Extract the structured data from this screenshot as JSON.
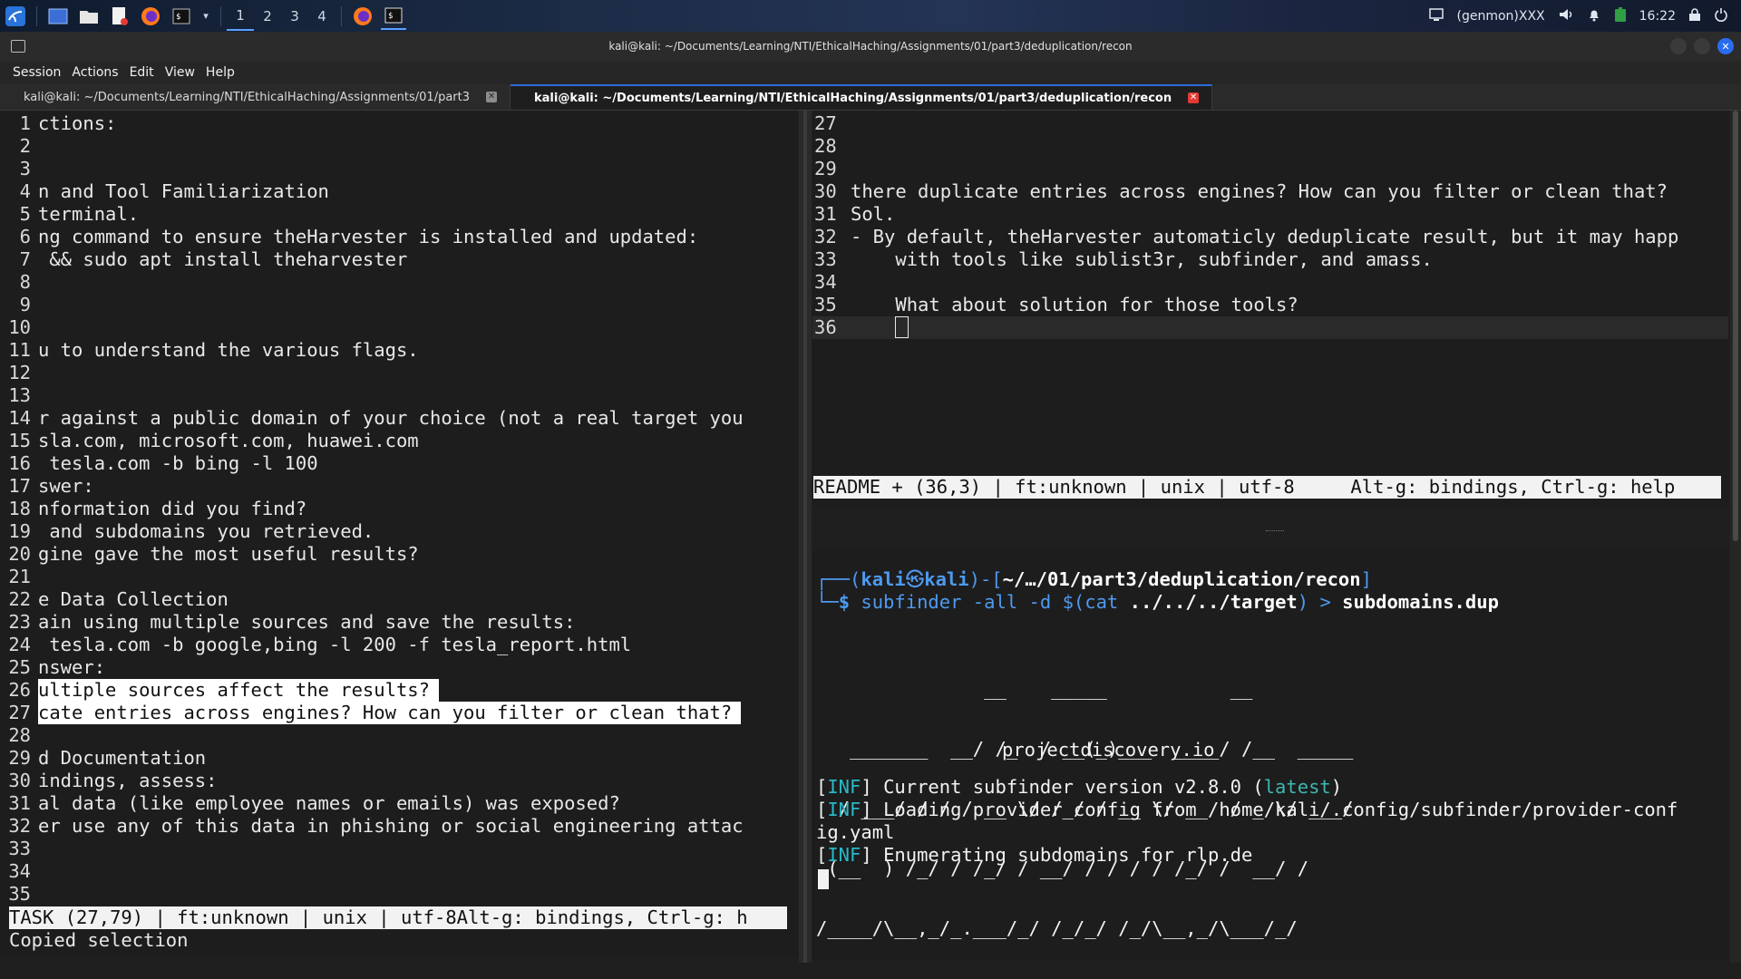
{
  "taskbar": {
    "workspaces": [
      "1",
      "2",
      "3",
      "4"
    ],
    "genmon": "(genmon)XXX",
    "clock": "16:22"
  },
  "window": {
    "title": "kali@kali: ~/Documents/Learning/NTI/EthicalHaching/Assignments/01/part3/deduplication/recon"
  },
  "menu": [
    "Session",
    "Actions",
    "Edit",
    "View",
    "Help"
  ],
  "tabs": [
    {
      "label": "kali@kali: ~/Documents/Learning/NTI/EthicalHaching/Assignments/01/part3",
      "active": false
    },
    {
      "label": "kali@kali: ~/Documents/Learning/NTI/EthicalHaching/Assignments/01/part3/deduplication/recon",
      "active": true
    }
  ],
  "left_editor": {
    "lines": [
      {
        "n": "1",
        "t": "ctions:"
      },
      {
        "n": "2",
        "t": ""
      },
      {
        "n": "3",
        "t": ""
      },
      {
        "n": "4",
        "t": "n and Tool Familiarization"
      },
      {
        "n": "5",
        "t": "terminal."
      },
      {
        "n": "6",
        "t": "ng command to ensure theHarvester is installed and updated:"
      },
      {
        "n": "7",
        "t": " && sudo apt install theharvester"
      },
      {
        "n": "8",
        "t": ""
      },
      {
        "n": "9",
        "t": ""
      },
      {
        "n": "10",
        "t": ""
      },
      {
        "n": "11",
        "t": "u to understand the various flags."
      },
      {
        "n": "12",
        "t": ""
      },
      {
        "n": "13",
        "t": ""
      },
      {
        "n": "14",
        "t": "r against a public domain of your choice (not a real target you"
      },
      {
        "n": "15",
        "t": "sla.com, microsoft.com, huawei.com"
      },
      {
        "n": "16",
        "t": " tesla.com -b bing -l 100"
      },
      {
        "n": "17",
        "t": "swer:"
      },
      {
        "n": "18",
        "t": "nformation did you find?"
      },
      {
        "n": "19",
        "t": " and subdomains you retrieved."
      },
      {
        "n": "20",
        "t": "gine gave the most useful results?"
      },
      {
        "n": "21",
        "t": ""
      },
      {
        "n": "22",
        "t": "e Data Collection"
      },
      {
        "n": "23",
        "t": "ain using multiple sources and save the results:"
      },
      {
        "n": "24",
        "t": " tesla.com -b google,bing -l 200 -f tesla_report.html"
      },
      {
        "n": "25",
        "t": "nswer:"
      },
      {
        "n": "26",
        "t": "ultiple sources affect the results?"
      },
      {
        "n": "27",
        "t": "cate entries across engines? How can you filter or clean that?"
      },
      {
        "n": "28",
        "t": ""
      },
      {
        "n": "29",
        "t": "d Documentation"
      },
      {
        "n": "30",
        "t": "indings, assess:"
      },
      {
        "n": "31",
        "t": "al data (like employee names or emails) was exposed?"
      },
      {
        "n": "32",
        "t": "er use any of this data in phishing or social engineering attac"
      },
      {
        "n": "33",
        "t": ""
      },
      {
        "n": "34",
        "t": ""
      },
      {
        "n": "35",
        "t": ""
      }
    ],
    "status": "TASK (27,79) | ft:unknown | unix | utf-8Alt-g: bindings, Ctrl-g: h",
    "message": "Copied selection"
  },
  "right_editor": {
    "lines": [
      {
        "n": "27",
        "t": ""
      },
      {
        "n": "28",
        "t": ""
      },
      {
        "n": "29",
        "t": ""
      },
      {
        "n": "30",
        "t": "there duplicate entries across engines? How can you filter or clean that?"
      },
      {
        "n": "31",
        "t": "Sol."
      },
      {
        "n": "32",
        "t": "- By default, theHarvester automaticly deduplicate result, but it may happ"
      },
      {
        "n": "33",
        "t": "    with tools like sublist3r, subfinder, and amass."
      },
      {
        "n": "34",
        "t": ""
      },
      {
        "n": "35",
        "t": "    What about solution for those tools?"
      },
      {
        "n": "36",
        "t": "    "
      }
    ],
    "status": "README + (36,3) | ft:unknown | unix | utf-8     Alt-g: bindings, Ctrl-g: help"
  },
  "terminal": {
    "prompt_user": "kali",
    "prompt_at": "㉿",
    "prompt_host": "kali",
    "prompt_path": "~/…/01/part3/deduplication/recon",
    "cmd_name": "subfinder",
    "cmd_args": " -all -d ",
    "cmd_sub_open": "$(",
    "cmd_cat": "cat",
    "cmd_target": " ../../../target",
    "cmd_sub_close": ")",
    "cmd_redirect": " > ",
    "cmd_outfile": "subdomains.dup",
    "banner": [
      "               __    _____           __         ",
      "   _______  __/ /_  / __(_)___  ____/ /__  _____",
      "  / ___/ / / / __ \\/ /_/ / __ \\/ __  / _ \\/ ___/",
      " (__  ) /_/ / /_/ / __/ / / / / /_/ /  __/ /    ",
      "/____/\\__,_/_.___/_/ /_/_/ /_/\\__,_/\\___/_/     "
    ],
    "site": "projectdiscovery.io",
    "logs": [
      {
        "tag": "INF",
        "pre": "Current subfinder version v2.8.0 (",
        "hl": "latest",
        "post": ")"
      },
      {
        "tag": "INF",
        "pre": "Loading provider config from /home/kali/.config/subfinder/provider-conf",
        "hl": "",
        "post": ""
      },
      {
        "tag": "",
        "pre": "ig.yaml",
        "hl": "",
        "post": ""
      },
      {
        "tag": "INF",
        "pre": "Enumerating subdomains for rlp.de",
        "hl": "",
        "post": ""
      }
    ]
  },
  "colors": {
    "accent": "#2d6ddf",
    "prompt_blue": "#4e9af0",
    "teal": "#29b8c7"
  }
}
